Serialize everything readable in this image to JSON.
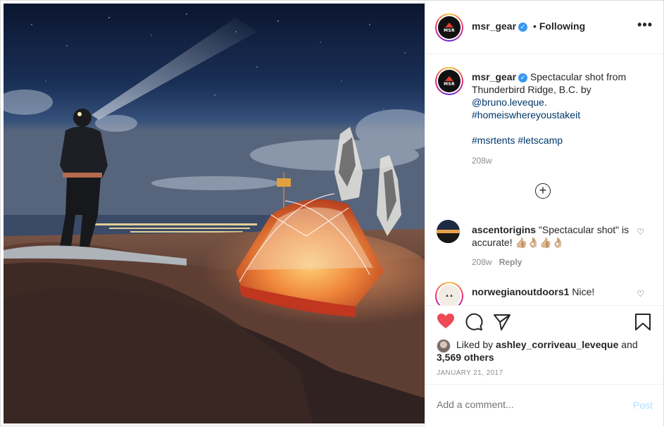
{
  "header": {
    "username": "msr_gear",
    "separator": "•",
    "follow_status": "Following",
    "more_icon": "more-dots-icon"
  },
  "caption": {
    "username": "msr_gear",
    "text_1": "Spectacular shot from Thunderbird Ridge, B.C. by",
    "mention": "@bruno.leveque",
    "text_2": ".",
    "hashtag_1": "#homeiswhereyoustakeit",
    "hashtag_2": "#msrtents",
    "hashtag_3": "#letscamp",
    "time": "208w"
  },
  "load_more_icon": "plus-circle-icon",
  "comments": [
    {
      "username": "ascentorigins",
      "text": "\"Spectacular shot\" is accurate! 👍🏼👌🏼👍🏼👌🏼",
      "time": "208w",
      "reply": "Reply"
    },
    {
      "username": "norwegianoutdoors1",
      "text": "Nice!"
    }
  ],
  "actions": {
    "like_icon": "heart-filled-icon",
    "comment_icon": "comment-icon",
    "share_icon": "share-icon",
    "save_icon": "bookmark-icon"
  },
  "likes": {
    "prefix": "Liked by",
    "user": "ashley_corriveau_leveque",
    "conj": "and",
    "count": "3,569 others"
  },
  "date": "JANUARY 21, 2017",
  "add_comment": {
    "placeholder": "Add a comment...",
    "post_label": "Post"
  },
  "colors": {
    "like": "#ed4956",
    "link": "#00376b",
    "verified": "#3897f0",
    "post_disabled": "#b2dffc"
  }
}
